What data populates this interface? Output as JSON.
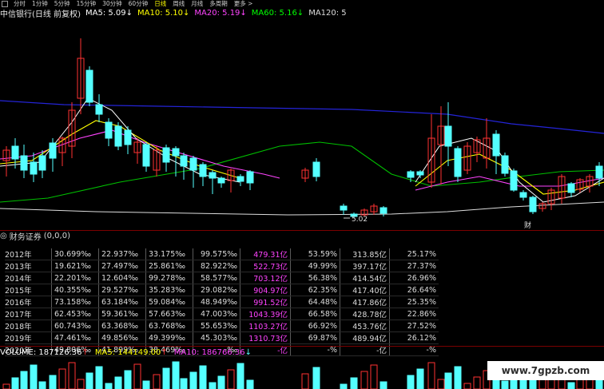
{
  "toolbar": {
    "items": [
      "分时",
      "1分钟",
      "5分钟",
      "15分钟",
      "30分钟",
      "60分钟",
      "日线",
      "周线",
      "月线",
      "多周期",
      "更多 >"
    ],
    "active_index": 6
  },
  "title": "中信银行(日线 前复权)",
  "ma_legend": [
    {
      "label": "MA5:",
      "value": "5.09",
      "arrow": "↓",
      "color": "#ffffff"
    },
    {
      "label": "MA10:",
      "value": "5.10",
      "arrow": "↓",
      "color": "#ffff00"
    },
    {
      "label": "MA20:",
      "value": "5.19",
      "arrow": "↓",
      "color": "#ff44ff"
    },
    {
      "label": "MA60:",
      "value": "5.16",
      "arrow": "↓",
      "color": "#00ff00"
    },
    {
      "label": "MA120:",
      "value": "5",
      "arrow": "",
      "color": "#dcdcdc"
    }
  ],
  "low_price_label": "5.02",
  "cai_label": "财",
  "fin_header": {
    "icon": "◎",
    "title": "财务证券",
    "args": "(0,0,0)"
  },
  "fin_rows": [
    [
      "2012年",
      "30.699‰",
      "22.937‰",
      "33.175‰",
      "99.575‰",
      "479.31亿",
      "53.59%",
      "313.85亿",
      "25.17%"
    ],
    [
      "2013年",
      "19.621‰",
      "27.497‰",
      "25.861‰",
      "82.922‰",
      "522.73亿",
      "49.99%",
      "397.17亿",
      "27.37%"
    ],
    [
      "2014年",
      "22.201‰",
      "12.604‰",
      "99.278‰",
      "58.577‰",
      "703.12亿",
      "56.38%",
      "414.54亿",
      "26.96%"
    ],
    [
      "2015年",
      "40.355‰",
      "29.527‰",
      "35.283‰",
      "29.082‰",
      "904.97亿",
      "62.35%",
      "417.40亿",
      "26.64%"
    ],
    [
      "2016年",
      "73.158‰",
      "63.184‰",
      "59.084‰",
      "48.949‰",
      "991.52亿",
      "64.48%",
      "417.86亿",
      "25.35%"
    ],
    [
      "2017年",
      "62.453‰",
      "59.361‰",
      "57.663‰",
      "47.003‰",
      "1043.39亿",
      "66.58%",
      "428.78亿",
      "22.86%"
    ],
    [
      "2018年",
      "60.743‰",
      "63.368‰",
      "63.768‰",
      "55.653‰",
      "1103.27亿",
      "66.92%",
      "453.76亿",
      "27.52%"
    ],
    [
      "2019年",
      "47.461‰",
      "49.856‰",
      "49.399‰",
      "45.303‰",
      "1310.73亿",
      "69.87%",
      "489.94亿",
      "26.12%"
    ],
    [
      "2020年",
      "49.806‰",
      "41.899‰",
      "38.469‰",
      "-‰",
      "-亿",
      "-%",
      "-亿",
      "-%"
    ]
  ],
  "volume_legend": [
    {
      "label": "VOLUME:",
      "value": "187126.36",
      "arrow": "↑",
      "color": "#ffffff"
    },
    {
      "label": "MA5:",
      "value": "144149.00",
      "arrow": "↑",
      "color": "#ffff00"
    },
    {
      "label": "MA10:",
      "value": "186766.36",
      "arrow": "↓",
      "color": "#ff44ff"
    }
  ],
  "watermark": "www.7gpzb.com",
  "colors": {
    "up": "#ff3232",
    "down": "#54ffff",
    "ma5": "#ffffff",
    "ma10": "#ffff00",
    "ma20": "#ff44ff",
    "ma60": "#00c000",
    "ma120": "#dcdcdc",
    "long_ma": "#2424d8"
  }
}
